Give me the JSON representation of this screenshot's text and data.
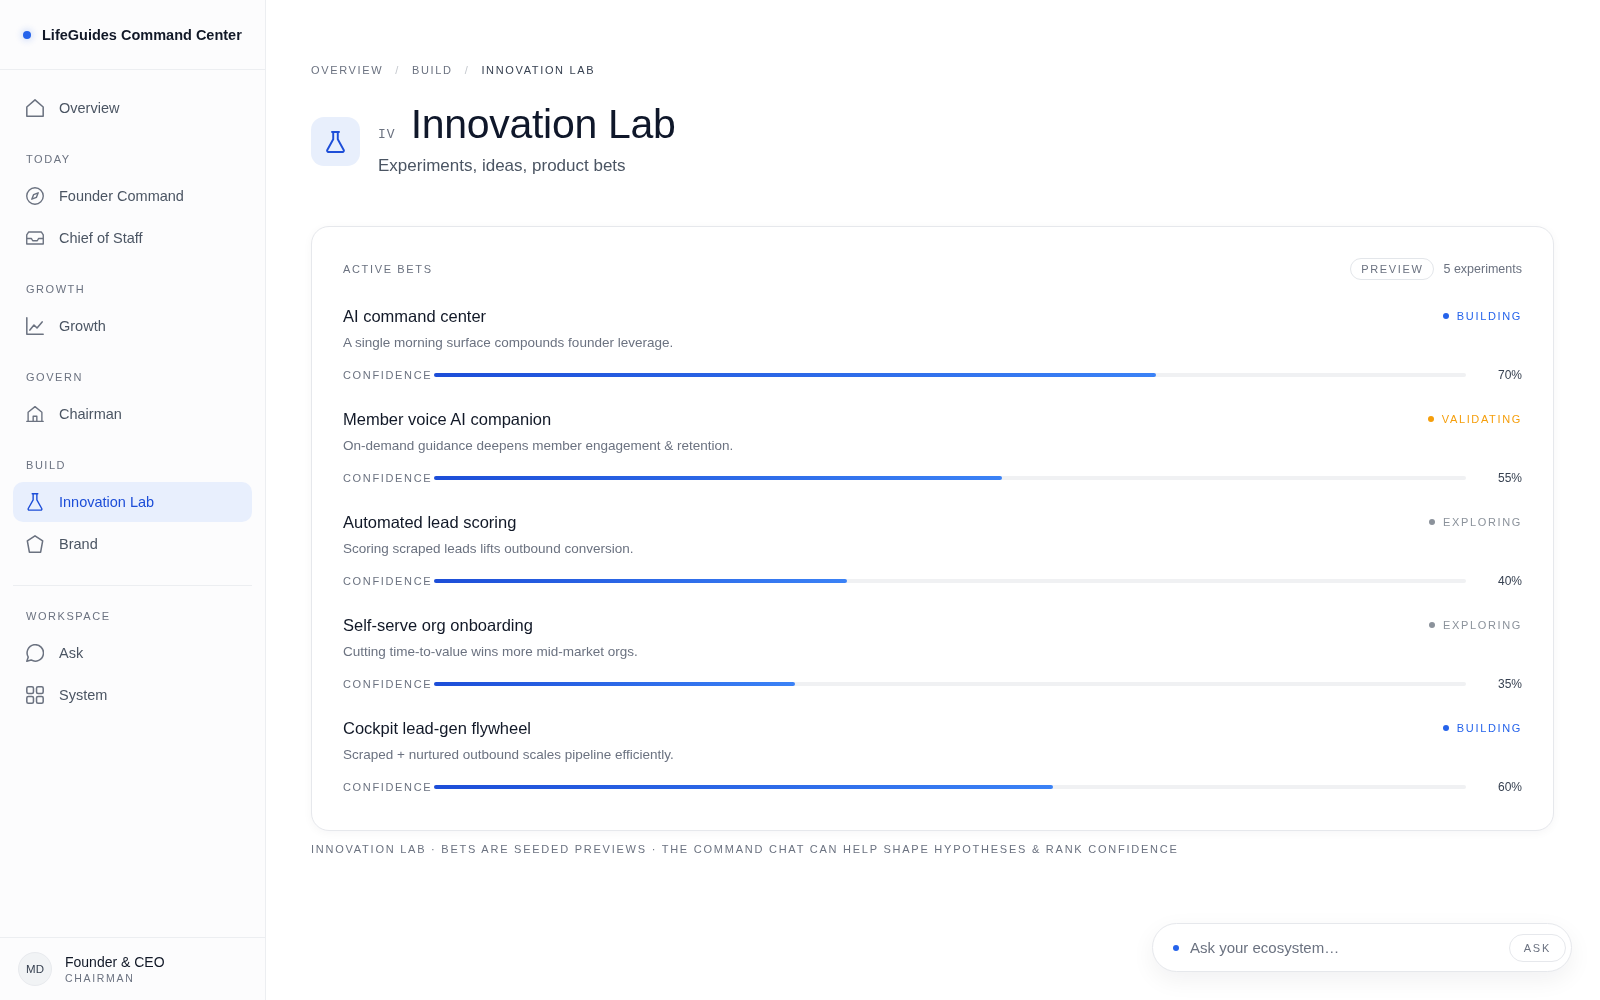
{
  "sidebar": {
    "brand": "LifeGuides Command Center",
    "groups": [
      {
        "items": [
          {
            "label": "Overview",
            "selected": false
          }
        ]
      },
      {
        "label": "TODAY",
        "items": [
          {
            "label": "Founder Command",
            "selected": false
          },
          {
            "label": "Chief of Staff",
            "selected": false
          }
        ]
      },
      {
        "label": "GROWTH",
        "items": [
          {
            "label": "Growth",
            "selected": false
          }
        ]
      },
      {
        "label": "GOVERN",
        "items": [
          {
            "label": "Chairman",
            "selected": false
          }
        ]
      },
      {
        "label": "BUILD",
        "items": [
          {
            "label": "Innovation Lab",
            "selected": true
          },
          {
            "label": "Brand",
            "selected": false
          }
        ]
      }
    ],
    "workspace": {
      "label": "WORKSPACE",
      "items": [
        {
          "label": "Ask",
          "selected": false
        },
        {
          "label": "System",
          "selected": false
        }
      ]
    },
    "user": {
      "initials": "MD",
      "name": "Founder & CEO",
      "role": "CHAIRMAN"
    }
  },
  "breadcrumb": [
    {
      "text": "OVERVIEW",
      "kind": "link"
    },
    {
      "text": "/",
      "kind": "separator"
    },
    {
      "text": "BUILD",
      "kind": "link"
    },
    {
      "text": "/",
      "kind": "separator"
    },
    {
      "text": "INNOVATION LAB",
      "kind": "current"
    }
  ],
  "header": {
    "numeral": "IV",
    "title": "Innovation Lab",
    "subtitle": "Experiments, ideas, product bets"
  },
  "card": {
    "label": "ACTIVE BETS",
    "badge": "PREVIEW",
    "count": "5 experiments",
    "bets": [
      {
        "title": "AI command center",
        "description": "A single morning surface compounds founder leverage.",
        "status": "BUILDING",
        "color": "#2563eb",
        "confidence_label": "CONFIDENCE",
        "level": 0.7,
        "reading": "70%"
      },
      {
        "title": "Member voice AI companion",
        "description": "On-demand guidance deepens member engagement & retention.",
        "status": "VALIDATING",
        "color": "#f59e0b",
        "confidence_label": "CONFIDENCE",
        "level": 0.55,
        "reading": "55%"
      },
      {
        "title": "Automated lead scoring",
        "description": "Scoring scraped leads lifts outbound conversion.",
        "status": "EXPLORING",
        "color": "#8b929b",
        "confidence_label": "CONFIDENCE",
        "level": 0.4,
        "reading": "40%"
      },
      {
        "title": "Self-serve org onboarding",
        "description": "Cutting time-to-value wins more mid-market orgs.",
        "status": "EXPLORING",
        "color": "#8b929b",
        "confidence_label": "CONFIDENCE",
        "level": 0.35,
        "reading": "35%"
      },
      {
        "title": "Cockpit lead-gen flywheel",
        "description": "Scraped + nurtured outbound scales pipeline efficiently.",
        "status": "BUILDING",
        "color": "#2563eb",
        "confidence_label": "CONFIDENCE",
        "level": 0.6,
        "reading": "60%"
      }
    ]
  },
  "footnote": "INNOVATION LAB · BETS ARE SEEDED PREVIEWS · THE COMMAND CHAT CAN HELP SHAPE HYPOTHESES & RANK CONFIDENCE",
  "ask_bar": {
    "placeholder": "Ask your ecosystem…",
    "button": "ASK"
  }
}
